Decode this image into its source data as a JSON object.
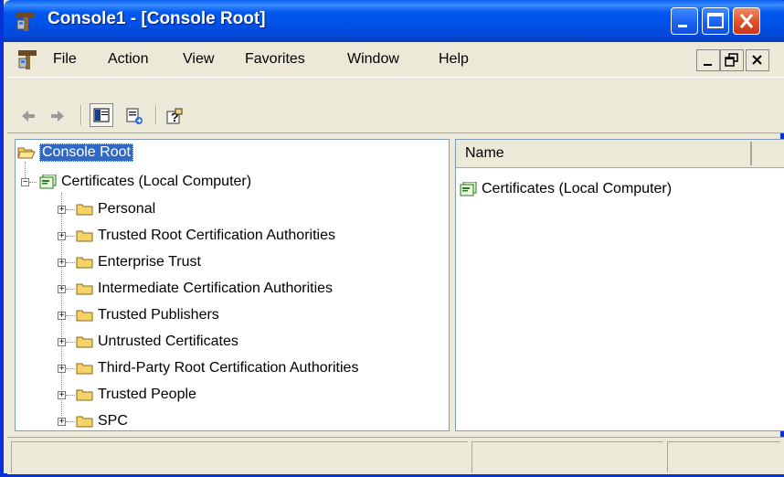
{
  "window": {
    "title": "Console1 - [Console Root]"
  },
  "menubar": {
    "items": [
      "File",
      "Action",
      "View",
      "Favorites",
      "Window",
      "Help"
    ]
  },
  "tree": {
    "root": "Console Root",
    "computer": "Certificates (Local Computer)",
    "stores": [
      "Personal",
      "Trusted Root Certification Authorities",
      "Enterprise Trust",
      "Intermediate Certification Authorities",
      "Trusted Publishers",
      "Untrusted Certificates",
      "Third-Party Root Certification Authorities",
      "Trusted People",
      "SPC"
    ]
  },
  "list": {
    "column_name": "Name",
    "items": [
      "Certificates (Local Computer)"
    ]
  },
  "colors": {
    "titlebar": "#0058ee",
    "selection": "#316ac5",
    "folder": "#f5d36b"
  }
}
